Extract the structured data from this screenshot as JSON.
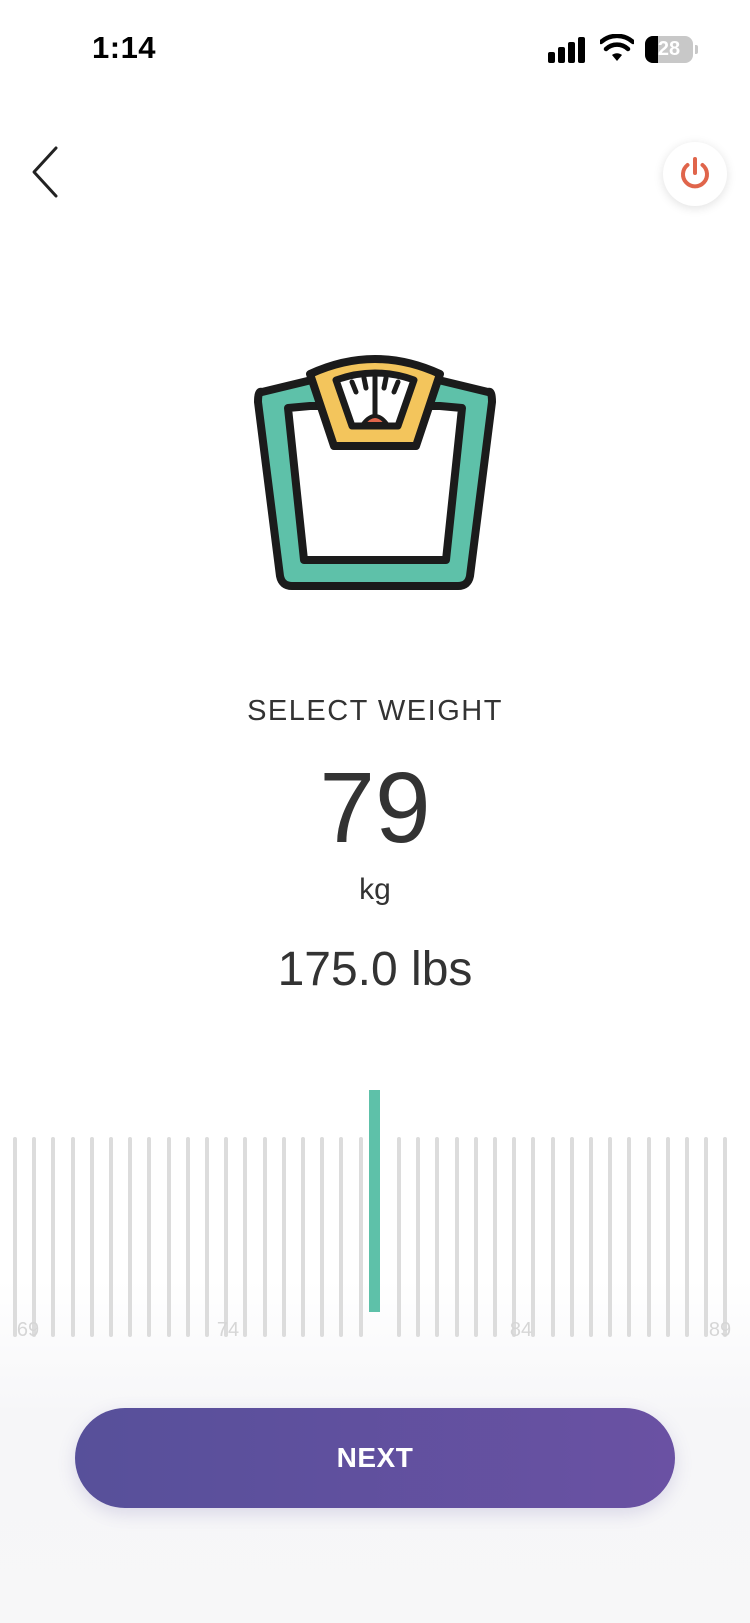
{
  "status_bar": {
    "time": "1:14",
    "battery_level": "28",
    "battery_fraction": 0.28,
    "icons": [
      "signal-icon",
      "wifi-icon",
      "battery-icon"
    ]
  },
  "nav": {
    "back_icon": "chevron-left-icon",
    "power_icon": "power-icon",
    "power_color": "#e0654b"
  },
  "illustration": {
    "icon": "weighing-scale-icon",
    "colors": {
      "body": "#5ec1a9",
      "dial": "#f3c55c",
      "needle": "#e0654b",
      "outline": "#1b1b1b"
    }
  },
  "weight": {
    "title": "SELECT WEIGHT",
    "value": "79",
    "unit": "kg",
    "lbs": "175.0 lbs"
  },
  "ruler": {
    "selected": 79,
    "indicator_color": "#5ec1a9",
    "labels": [
      "69",
      "74",
      "84",
      "89"
    ]
  },
  "next_button": {
    "label": "NEXT",
    "gradient": [
      "#57509a",
      "#6a51a3"
    ]
  }
}
